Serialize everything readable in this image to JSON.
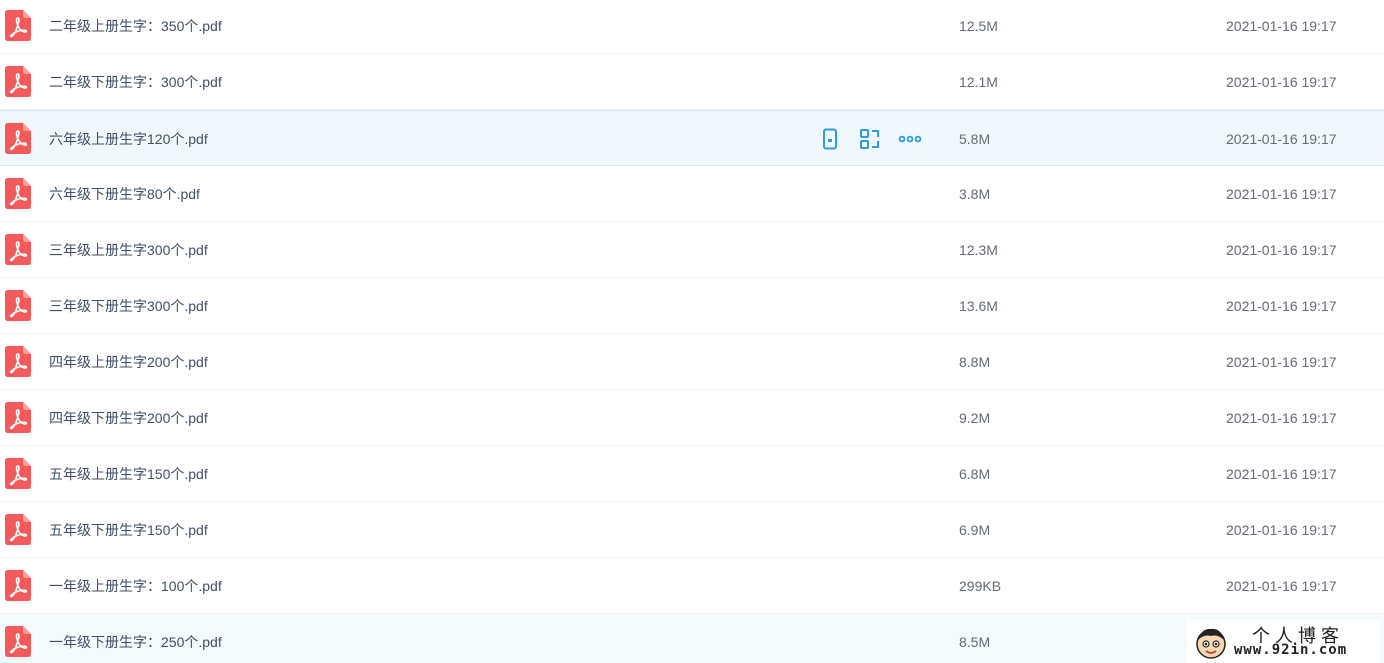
{
  "colors": {
    "pdf_icon": "#f35b5b",
    "action_icon": "#2e9be6",
    "hover_row": "#f1f8fd",
    "text": "#424e67"
  },
  "files": [
    {
      "name": "二年级上册生字：350个.pdf",
      "size": "12.5M",
      "time": "2021-01-16 19:17",
      "icon": "pdf-icon"
    },
    {
      "name": "二年级下册生字：300个.pdf",
      "size": "12.1M",
      "time": "2021-01-16 19:17",
      "icon": "pdf-icon"
    },
    {
      "name": "六年级上册生字120个.pdf",
      "size": "5.8M",
      "time": "2021-01-16 19:17",
      "icon": "pdf-icon",
      "hovered": true
    },
    {
      "name": "六年级下册生字80个.pdf",
      "size": "3.8M",
      "time": "2021-01-16 19:17",
      "icon": "pdf-icon"
    },
    {
      "name": "三年级上册生字300个.pdf",
      "size": "12.3M",
      "time": "2021-01-16 19:17",
      "icon": "pdf-icon"
    },
    {
      "name": "三年级下册生字300个.pdf",
      "size": "13.6M",
      "time": "2021-01-16 19:17",
      "icon": "pdf-icon"
    },
    {
      "name": "四年级上册生字200个.pdf",
      "size": "8.8M",
      "time": "2021-01-16 19:17",
      "icon": "pdf-icon"
    },
    {
      "name": "四年级下册生字200个.pdf",
      "size": "9.2M",
      "time": "2021-01-16 19:17",
      "icon": "pdf-icon"
    },
    {
      "name": "五年级上册生字150个.pdf",
      "size": "6.8M",
      "time": "2021-01-16 19:17",
      "icon": "pdf-icon"
    },
    {
      "name": "五年级下册生字150个.pdf",
      "size": "6.9M",
      "time": "2021-01-16 19:17",
      "icon": "pdf-icon"
    },
    {
      "name": "一年级上册生字：100个.pdf",
      "size": "299KB",
      "time": "2021-01-16 19:17",
      "icon": "pdf-icon"
    },
    {
      "name": "一年级下册生字：250个.pdf",
      "size": "8.5M",
      "time": "",
      "icon": "pdf-icon"
    }
  ],
  "row_actions": [
    {
      "name": "send-to-phone-button",
      "icon": "phone-icon"
    },
    {
      "name": "share-button",
      "icon": "share-link-icon"
    },
    {
      "name": "more-button",
      "icon": "more-dots-icon"
    }
  ],
  "watermark": {
    "title": "个人博客",
    "url": "www.92in.com",
    "icon": "cartoon-face-icon"
  }
}
